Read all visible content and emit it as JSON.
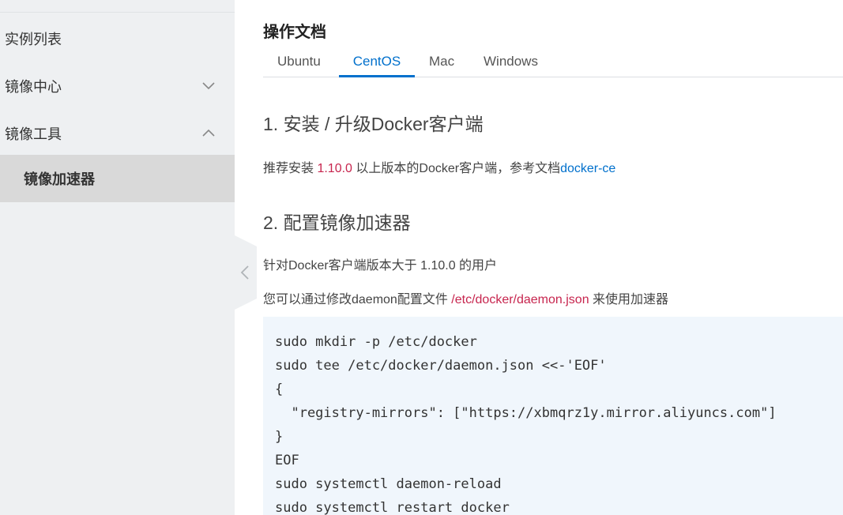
{
  "sidebar": {
    "items": [
      {
        "label": "实例列表"
      },
      {
        "label": "镜像中心",
        "state": "collapsed"
      },
      {
        "label": "镜像工具",
        "state": "expanded"
      }
    ],
    "sub_items": [
      {
        "label": "镜像加速器",
        "selected": true
      }
    ]
  },
  "main": {
    "title": "操作文档",
    "tabs": [
      {
        "label": "Ubuntu"
      },
      {
        "label": "CentOS",
        "active": true
      },
      {
        "label": "Mac"
      },
      {
        "label": "Windows"
      }
    ],
    "section1": {
      "heading": "1. 安装 / 升级Docker客户端",
      "text_prefix": "推荐安装 ",
      "version": "1.10.0",
      "text_middle": " 以上版本的Docker客户端，参考文档",
      "link": "docker-ce"
    },
    "section2": {
      "heading": "2. 配置镜像加速器",
      "line1": "针对Docker客户端版本大于 1.10.0 的用户",
      "line2_prefix": "您可以通过修改daemon配置文件 ",
      "config_path": "/etc/docker/daemon.json",
      "line2_suffix": " 来使用加速器"
    },
    "code_lines": [
      "sudo mkdir -p /etc/docker",
      "sudo tee /etc/docker/daemon.json <<-'EOF'",
      "{",
      "  \"registry-mirrors\": [\"https://xbmqrz1y.mirror.aliyuncs.com\"]",
      "}",
      "EOF",
      "sudo systemctl daemon-reload",
      "sudo systemctl restart docker"
    ]
  },
  "colors": {
    "accent": "#0070cc",
    "code_highlight": "#c7254e",
    "sidebar_bg": "#eef0f2",
    "selected_bg": "#d9d9d9",
    "code_bg": "#f0f6fc"
  }
}
